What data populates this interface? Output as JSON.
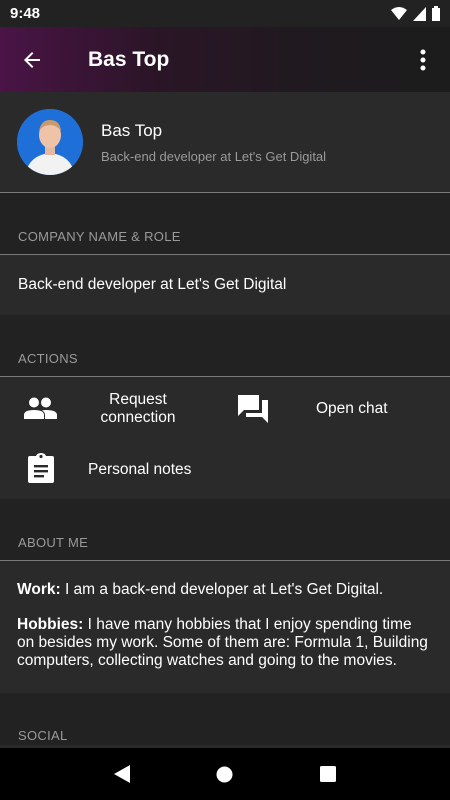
{
  "status_bar": {
    "time": "9:48"
  },
  "app_bar": {
    "title": "Bas Top"
  },
  "profile": {
    "name": "Bas Top",
    "subtitle": "Back-end developer at Let's Get Digital"
  },
  "company": {
    "header": "COMPANY NAME & ROLE",
    "value": "Back-end developer at Let's Get Digital"
  },
  "actions": {
    "header": "ACTIONS",
    "request_connection": "Request connection",
    "open_chat": "Open chat",
    "personal_notes": "Personal notes"
  },
  "about": {
    "header": "ABOUT ME",
    "work_label": "Work:",
    "work_text": " I am a back-end developer at Let's Get Digital.",
    "hobbies_label": "Hobbies:",
    "hobbies_text": " I have many hobbies that I enjoy spending time on besides my work. Some of them are: Formula 1, Building computers, collecting watches and going to the movies."
  },
  "social": {
    "header": "SOCIAL"
  },
  "icons": {
    "back": "arrow-back-icon",
    "more": "more-vert-icon",
    "people": "people-icon",
    "chat": "forum-icon",
    "notes": "clipboard-icon"
  },
  "colors": {
    "accent": "#4a1446",
    "background": "#2b2a2a",
    "section": "#232222"
  }
}
